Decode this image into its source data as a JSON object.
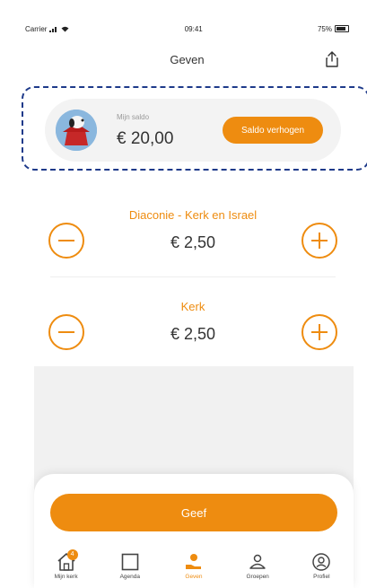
{
  "status_bar": {
    "carrier": "Carrier",
    "time": "09:41",
    "battery": "75%"
  },
  "nav": {
    "title": "Geven"
  },
  "balance": {
    "label": "Mijn saldo",
    "value": "€ 20,00",
    "topup_label": "Saldo verhogen"
  },
  "gifts": [
    {
      "name": "Diaconie - Kerk en Israel",
      "amount": "€ 2,50"
    },
    {
      "name": "Kerk",
      "amount": "€ 2,50"
    }
  ],
  "give_button_label": "Geef",
  "tabs": [
    {
      "label": "Mijn kerk",
      "icon": "home-icon",
      "badge": "4"
    },
    {
      "label": "Agenda",
      "icon": "calendar-icon"
    },
    {
      "label": "Geven",
      "icon": "give-icon",
      "active": true
    },
    {
      "label": "Groepen",
      "icon": "groups-icon"
    },
    {
      "label": "Profiel",
      "icon": "profile-icon"
    }
  ],
  "colors": {
    "accent": "#ee8c10",
    "highlight_border": "#1e3a8a"
  }
}
